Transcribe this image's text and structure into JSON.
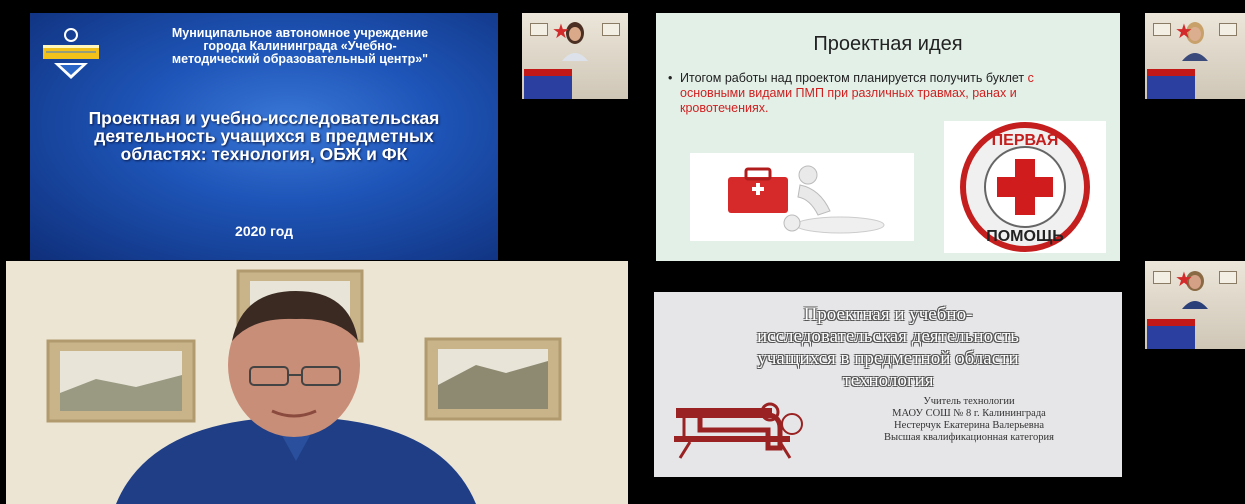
{
  "top_left_slide": {
    "org_line1": "Муниципальное автономное учреждение",
    "org_line2": "города Калининграда «Учебно-",
    "org_line3": "методический образовательный центр»\"",
    "title_line1": "Проектная и учебно-исследовательская",
    "title_line2": "деятельность учащихся в предметных",
    "title_line3": "областях: технология, ОБЖ и ФК",
    "year": "2020 год",
    "colors": {
      "background": "#1e55b8",
      "text": "#ffffff"
    }
  },
  "top_right_slide": {
    "heading": "Проектная идея",
    "bullet_symbol": "•",
    "bullet_text_part1": "Итогом работы над проектом планируется получить буклет ",
    "bullet_text_red": "с основными видами ПМП при различных травмах, ранах и кровотечениях",
    "bullet_text_end": ".",
    "badge_top": "ПЕРВАЯ",
    "badge_bottom": "ПОМОЩЬ",
    "colors": {
      "background": "#e2f0e8",
      "accent_red": "#d02020"
    }
  },
  "bottom_right_slide": {
    "title_line1": "Проектная и учебно-",
    "title_line2": "исследовательская деятельность",
    "title_line3": "учащихся в предметной области",
    "title_line4": "технология",
    "author_line1": "Учитель технологии",
    "author_line2": "МАОУ СОШ № 8 г. Калининграда",
    "author_line3": "Нестерчук Екатерина Валерьевна",
    "author_line4": "Высшая квалификационная категория"
  },
  "participants": [
    {
      "name": "participant-cam-1"
    },
    {
      "name": "participant-cam-2"
    },
    {
      "name": "participant-cam-3"
    },
    {
      "name": "main-speaker-cam"
    }
  ]
}
